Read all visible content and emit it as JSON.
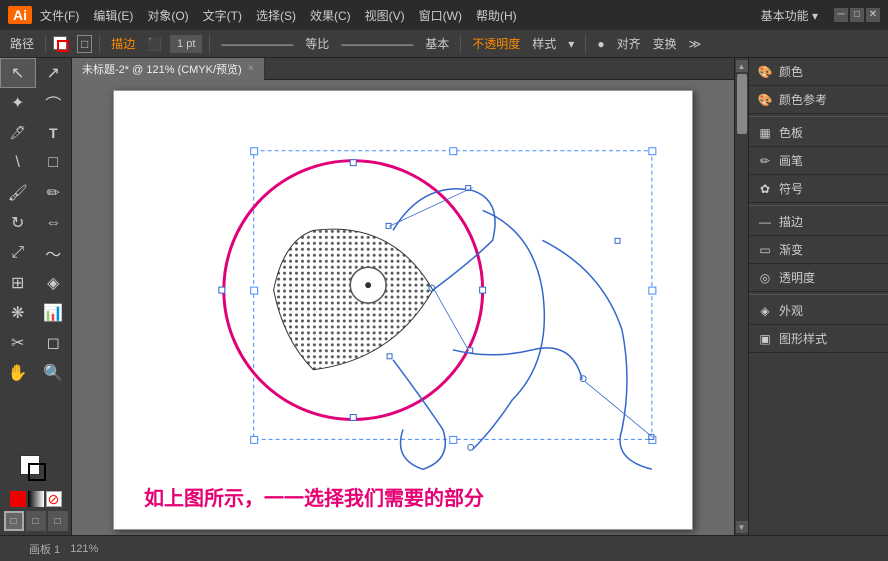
{
  "titlebar": {
    "logo": "Ai",
    "menus": [
      "文件(F)",
      "编辑(E)",
      "对象(O)",
      "文字(T)",
      "选择(S)",
      "效果(C)",
      "视图(V)",
      "窗口(W)",
      "帮助(H)"
    ],
    "workspace": "基本功能 ▾"
  },
  "toolbar": {
    "label": "路径",
    "stroke_icon": "✏",
    "shape_icon": "□",
    "mode": "描边",
    "weight": "1 pt",
    "line_style": "等比",
    "opacity_label": "不透明度",
    "opacity_style": "样式",
    "align": "对齐",
    "transform": "变换"
  },
  "tab": {
    "title": "未标题-2* @ 121% (CMYK/预览)",
    "close": "×"
  },
  "right_panel": {
    "items": [
      {
        "icon": "🎨",
        "label": "颜色"
      },
      {
        "icon": "🎨",
        "label": "颜色参考"
      },
      {
        "icon": "▦",
        "label": "色板"
      },
      {
        "icon": "✏",
        "label": "画笔"
      },
      {
        "icon": "✿",
        "label": "符号"
      },
      {
        "icon": "—",
        "label": "描边"
      },
      {
        "icon": "▭",
        "label": "渐变"
      },
      {
        "icon": "◎",
        "label": "透明度"
      },
      {
        "icon": "◈",
        "label": "外观"
      },
      {
        "icon": "▣",
        "label": "图形样式"
      }
    ]
  },
  "caption": "如上图所示，一一选择我们需要的部分",
  "status": {
    "left": "",
    "zoom": "121%"
  },
  "tools": [
    {
      "icon": "↖",
      "name": "selection-tool"
    },
    {
      "icon": "↖",
      "name": "direct-selection-tool"
    },
    {
      "icon": "✏",
      "name": "pen-tool"
    },
    {
      "icon": "T",
      "name": "type-tool"
    },
    {
      "icon": "✏",
      "name": "pencil-tool"
    },
    {
      "icon": "▭",
      "name": "shape-tool"
    },
    {
      "icon": "↔",
      "name": "rotate-tool"
    },
    {
      "icon": "⬠",
      "name": "warp-tool"
    },
    {
      "icon": "☞",
      "name": "free-transform"
    },
    {
      "icon": "🖋",
      "name": "symbol-spray"
    },
    {
      "icon": "📊",
      "name": "graph-tool"
    },
    {
      "icon": "✂",
      "name": "slice-tool"
    },
    {
      "icon": "✋",
      "name": "hand-tool"
    },
    {
      "icon": "🔍",
      "name": "zoom-tool"
    }
  ]
}
